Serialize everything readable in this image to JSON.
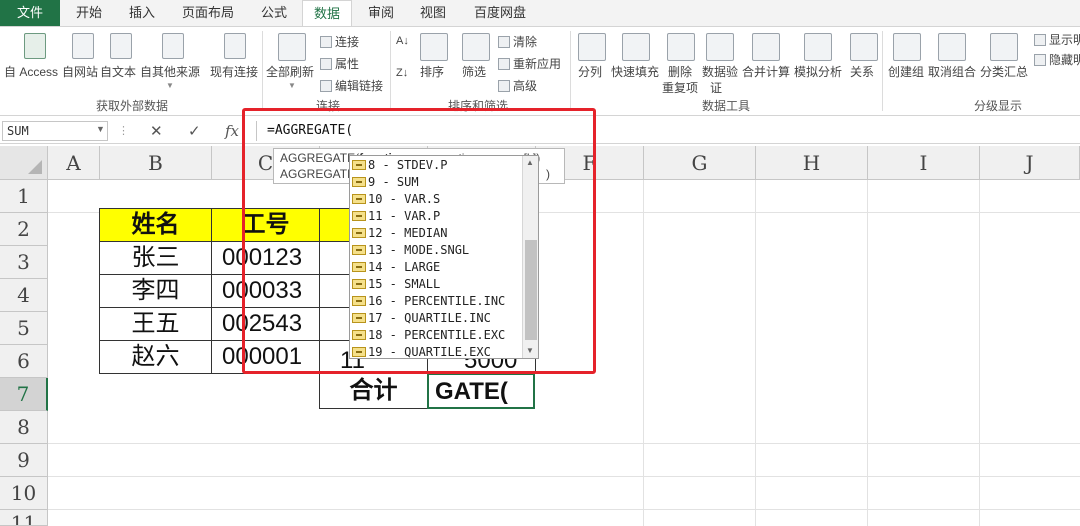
{
  "ribbon": {
    "tabs": [
      "文件",
      "开始",
      "插入",
      "页面布局",
      "公式",
      "数据",
      "审阅",
      "视图",
      "百度网盘"
    ],
    "active_tab": "数据",
    "accent_color": "#217346",
    "groups": {
      "external": {
        "label": "获取外部数据",
        "buttons": [
          "自 Access",
          "自网站",
          "自文本",
          "自其他来源",
          "现有连接"
        ]
      },
      "connections": {
        "label": "连接",
        "refresh_all": "全部刷新",
        "small": [
          "连接",
          "属性",
          "编辑链接"
        ]
      },
      "sort_filter": {
        "label": "排序和筛选",
        "sort": "排序",
        "filter": "筛选",
        "small": [
          "清除",
          "重新应用",
          "高级"
        ]
      },
      "data_tools": {
        "label": "数据工具",
        "buttons": [
          "分列",
          "快速填充",
          "删除",
          "重复项",
          "数据验",
          "证",
          "合并计算",
          "模拟分析",
          "关系"
        ]
      },
      "outline": {
        "label": "分级显示",
        "buttons": [
          "创建组",
          "取消组合",
          "分类汇总"
        ],
        "small": [
          "显示明",
          "隐藏明"
        ]
      }
    }
  },
  "formula_bar": {
    "name_box": "SUM",
    "cancel": "✕",
    "enter": "✓",
    "fx": "fx",
    "formula": "=AGGREGATE("
  },
  "grid": {
    "columns": [
      "A",
      "B",
      "C",
      "D",
      "E",
      "F",
      "G",
      "H",
      "I",
      "J"
    ],
    "rows": [
      "1",
      "2",
      "3",
      "4",
      "5",
      "6",
      "7",
      "8",
      "9",
      "10",
      "11"
    ],
    "selected_row": "7",
    "table": {
      "header": [
        "姓名",
        "工号"
      ],
      "rows": [
        [
          "张三",
          "000123"
        ],
        [
          "李四",
          "000033"
        ],
        [
          "王五",
          "002543"
        ],
        [
          "赵六",
          "000001"
        ]
      ],
      "d6_partial": "11",
      "e6_partial": "5000",
      "total_label": "合计",
      "active_cell_text": "GATE("
    },
    "header_fill": "#ffff00"
  },
  "autocomplete": {
    "tooltip_line1_prefix": "AGGREGATE(",
    "tooltip_line1_bold": "function_num",
    "tooltip_line1_rest": ", options, array, [k])",
    "tooltip_line2_prefix": "AGGREGATE(",
    "tooltip_line2_rest": ")",
    "items": [
      "8 - STDEV.P",
      "9 - SUM",
      "10 - VAR.S",
      "11 - VAR.P",
      "12 - MEDIAN",
      "13 - MODE.SNGL",
      "14 - LARGE",
      "15 - SMALL",
      "16 - PERCENTILE.INC",
      "17 - QUARTILE.INC",
      "18 - PERCENTILE.EXC",
      "19 - QUARTILE.EXC"
    ]
  },
  "annotation": {
    "highlight_color": "#e5222a"
  }
}
